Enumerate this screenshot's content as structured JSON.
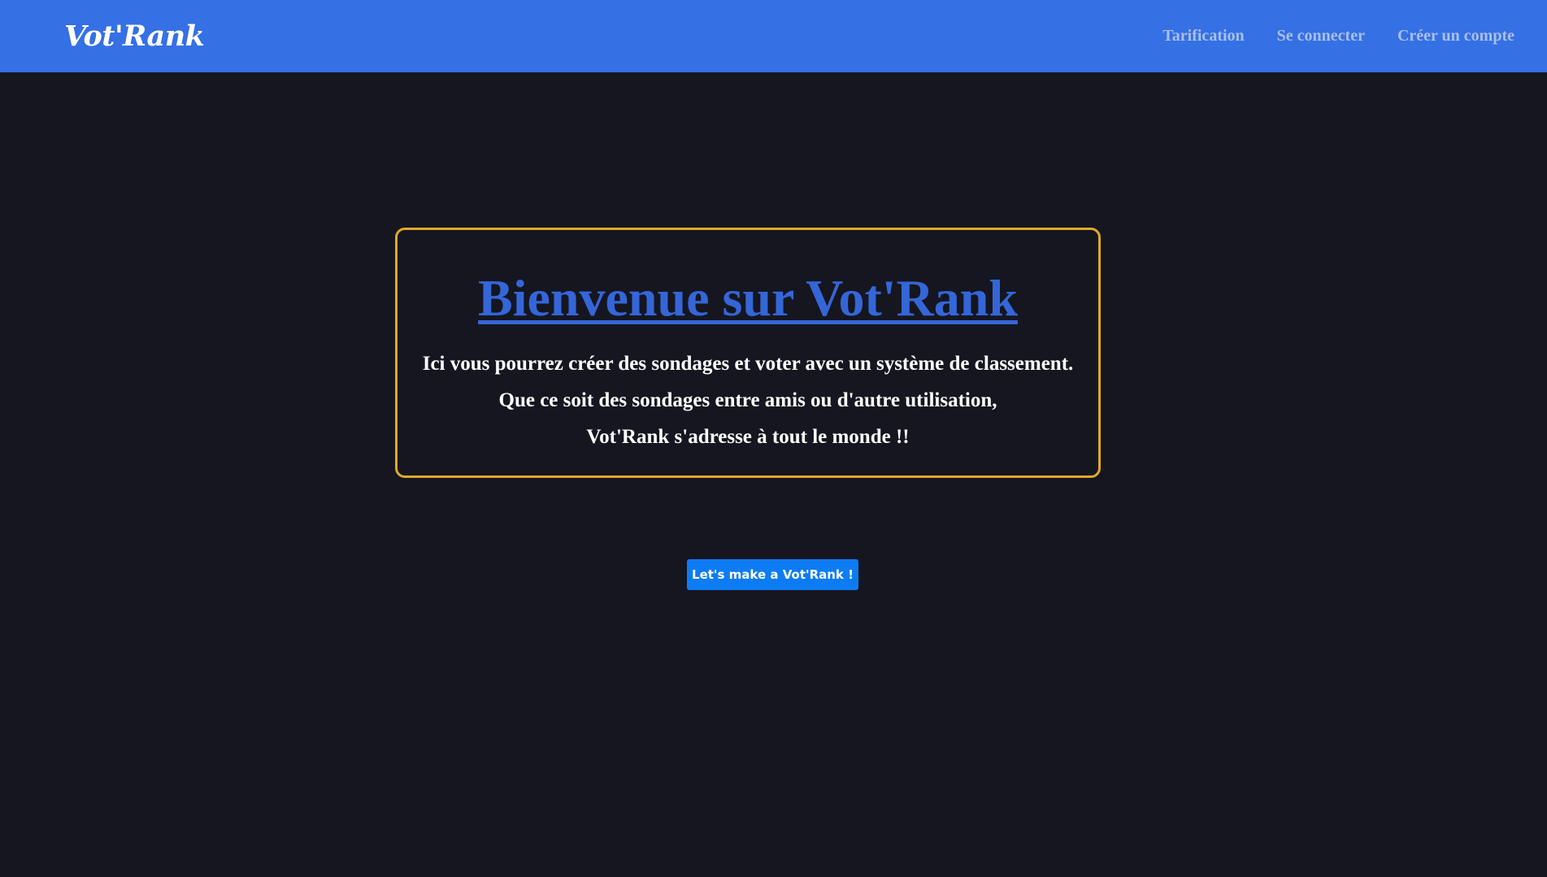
{
  "colors": {
    "background": "#151620",
    "navbar": "#3570e4",
    "nav_link": "#a9bfe8",
    "title": "#3566d8",
    "card_border": "#e0a92a",
    "button": "#0d7cf2"
  },
  "navbar": {
    "brand": "Vot'Rank",
    "links": [
      {
        "label": "Tarification"
      },
      {
        "label": "Se connecter"
      },
      {
        "label": "Créer un compte"
      }
    ]
  },
  "welcome": {
    "title": "Bienvenue sur Vot'Rank",
    "lines": [
      "Ici vous pourrez créer des sondages et voter avec un système de classement.",
      "Que ce soit des sondages entre amis ou d'autre utilisation,",
      "Vot'Rank s'adresse à tout le monde !!"
    ]
  },
  "cta": {
    "label": "Let's make a Vot'Rank !"
  }
}
